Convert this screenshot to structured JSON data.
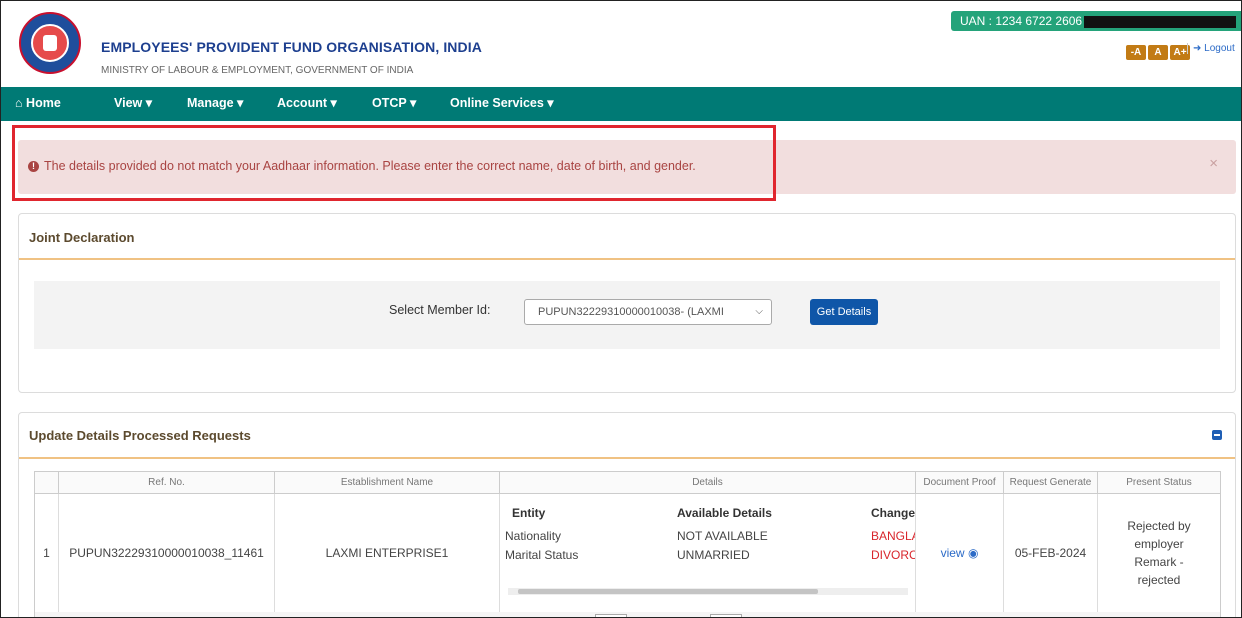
{
  "header": {
    "org_name": "EMPLOYEES' PROVIDENT FUND ORGANISATION, INDIA",
    "ministry": "MINISTRY OF LABOUR & EMPLOYMENT, GOVERNMENT OF INDIA",
    "uan_label": "UAN : 1234 6722 2606",
    "font_buttons": [
      "-A",
      "A",
      "A+"
    ],
    "logout_label": "Logout"
  },
  "nav": {
    "items": [
      "Home",
      "View",
      "Manage",
      "Account",
      "OTCP",
      "Online Services"
    ],
    "home_icon": "home-icon",
    "dropdown_caret": "▾"
  },
  "alert": {
    "message": "The details provided do not match your Aadhaar information. Please enter the correct name, date of birth, and gender.",
    "icon": "exclamation-circle-icon",
    "close": "×"
  },
  "joint_declaration": {
    "title": "Joint Declaration",
    "select_label": "Select Member Id:",
    "selected_value": "PUPUN32229310000010038- (LAXMI",
    "button_label": "Get Details"
  },
  "processed_requests": {
    "title": "Update Details Processed Requests",
    "columns": [
      "Ref. No.",
      "Establishment Name",
      "Details",
      "Document Proof",
      "Request Generate",
      "Present Status"
    ],
    "details_subheaders": [
      "Entity",
      "Available Details",
      "Change"
    ],
    "rows": [
      {
        "index": "1",
        "ref_no": "PUPUN32229310000010038_11461",
        "establishment": "LAXMI ENTERPRISE1",
        "details": [
          {
            "entity": "Nationality",
            "available": "NOT AVAILABLE",
            "change": "BANGLA"
          },
          {
            "entity": "Marital Status",
            "available": "UNMARRIED",
            "change": "DIVORC"
          }
        ],
        "document_proof": "view",
        "request_date": "05-FEB-2024",
        "status": "Rejected by employer Remark - rejected"
      }
    ]
  },
  "colors": {
    "nav_bg": "#007a75",
    "alert_bg": "#f2dede",
    "alert_text": "#a94442",
    "highlight_border": "#e0262e",
    "primary_button": "#0f56a8",
    "uan_badge": "#24a37a"
  }
}
